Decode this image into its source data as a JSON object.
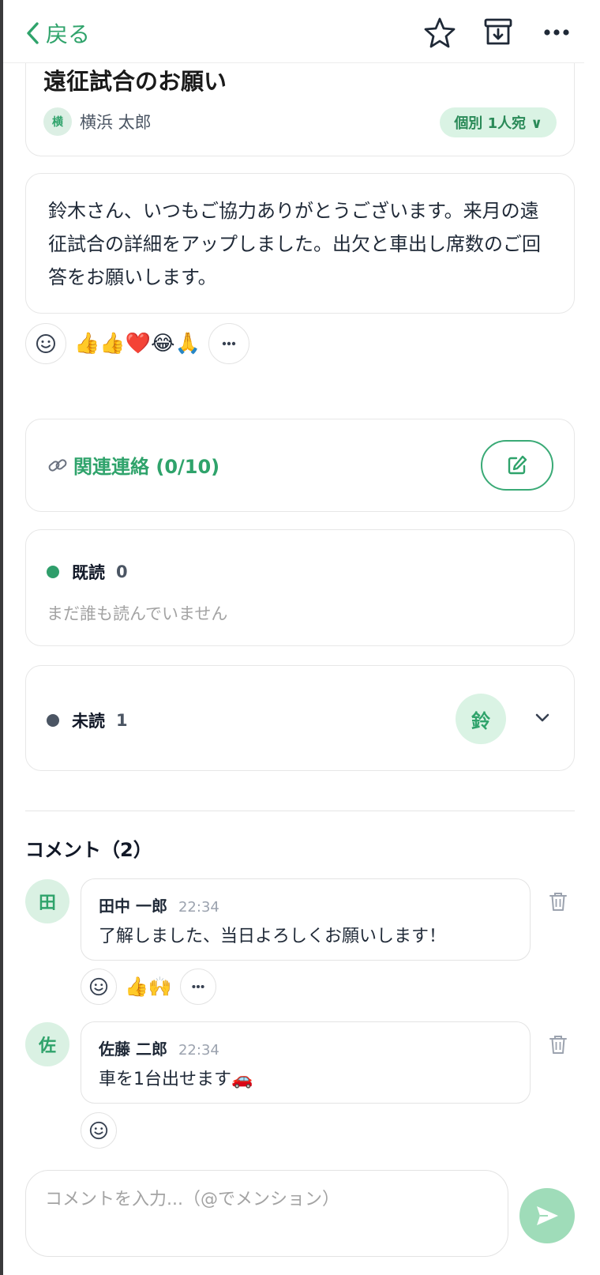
{
  "header": {
    "back_label": "戻る"
  },
  "message": {
    "title": "遠征試合のお願い",
    "author_initial": "横",
    "author_name": "横浜 太郎",
    "recipient_label": "個別 1人宛 ∨",
    "body": "鈴木さん、いつもご協力ありがとうございます。来月の遠征試合の詳細をアップしました。出欠と車出し席数のご回答をお願いします。",
    "reactions": "👍👍❤️😂🙏"
  },
  "related": {
    "label": "関連連絡 (0/10)"
  },
  "read_status": {
    "read_label": "既読",
    "read_count": "0",
    "read_empty": "まだ誰も読んでいません",
    "unread_label": "未読",
    "unread_count": "1",
    "unread_avatar": "鈴",
    "read_color": "#2f9e6b",
    "unread_color": "#4b5563"
  },
  "comments": {
    "title": "コメント（2）",
    "items": [
      {
        "initial": "田",
        "name": "田中 一郎",
        "time": "22:34",
        "text": "了解しました、当日よろしくお願いします！",
        "reactions": "👍🙌"
      },
      {
        "initial": "佐",
        "name": "佐藤 二郎",
        "time": "22:34",
        "text": "車を1台出せます🚗",
        "reactions": ""
      }
    ]
  },
  "composer": {
    "placeholder": "コメントを入力...（@でメンション）"
  },
  "colors": {
    "accent": "#2fa36b",
    "accent_light": "#daf3e4"
  }
}
